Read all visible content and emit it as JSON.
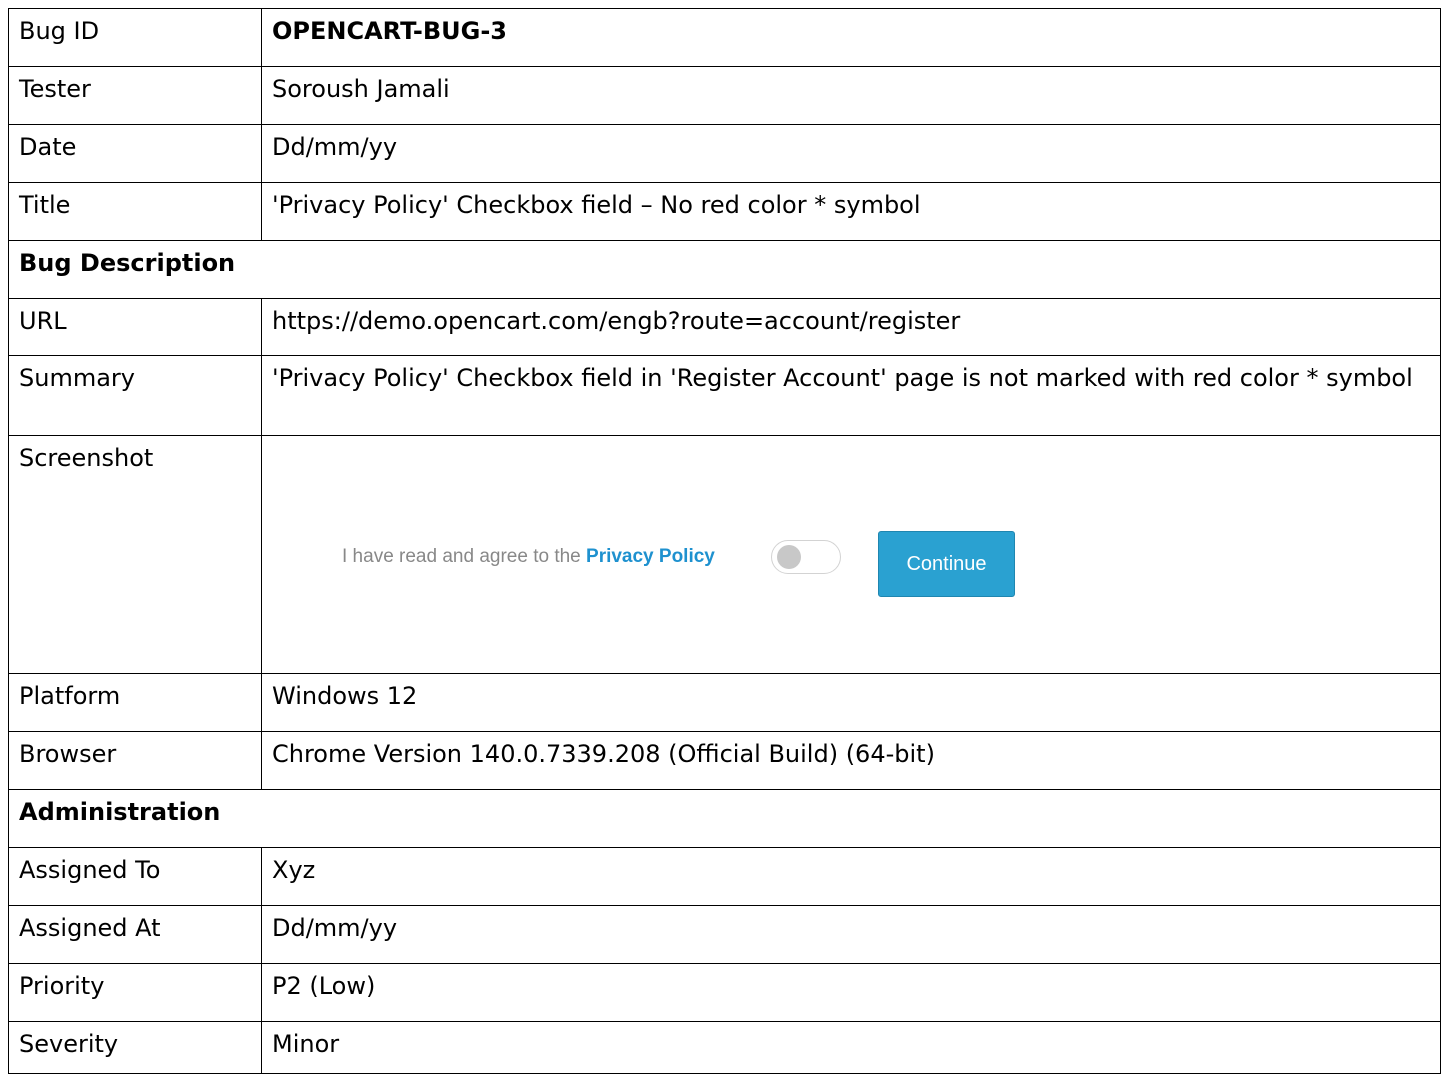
{
  "fields": [
    {
      "label": "Bug ID",
      "value": "OPENCART-BUG-3"
    },
    {
      "label": "Tester",
      "value": "Soroush Jamali"
    },
    {
      "label": "Date",
      "value": "Dd/mm/yy"
    },
    {
      "label": "Title",
      "value": "'Privacy Policy' Checkbox field – No red color * symbol"
    }
  ],
  "sections": {
    "description": "Bug Description",
    "administration": "Administration"
  },
  "description": {
    "url_label": "URL",
    "url_value": "https://demo.opencart.com/engb?route=account/register",
    "summary_label": "Summary",
    "summary_value": "'Privacy Policy' Checkbox field in 'Register Account' page is not marked with red color * symbol",
    "screenshot_label": "Screenshot",
    "platform_label": "Platform",
    "platform_value": "Windows 12",
    "browser_label": "Browser",
    "browser_value": "Chrome Version 140.0.7339.208 (Official Build) (64-bit)"
  },
  "screenshot": {
    "agree_text": "I have read and agree to the ",
    "privacy_link": "Privacy Policy",
    "toggle_state": "off",
    "continue_label": "Continue",
    "accent_color": "#1e91cf",
    "button_color": "#2aa1d1"
  },
  "administration": {
    "assigned_to_label": "Assigned To",
    "assigned_to_value": "Xyz",
    "assigned_at_label": "Assigned At",
    "assigned_at_value": "Dd/mm/yy",
    "priority_label": "Priority",
    "priority_value": "P2 (Low)",
    "severity_label": "Severity",
    "severity_value": "Minor"
  }
}
